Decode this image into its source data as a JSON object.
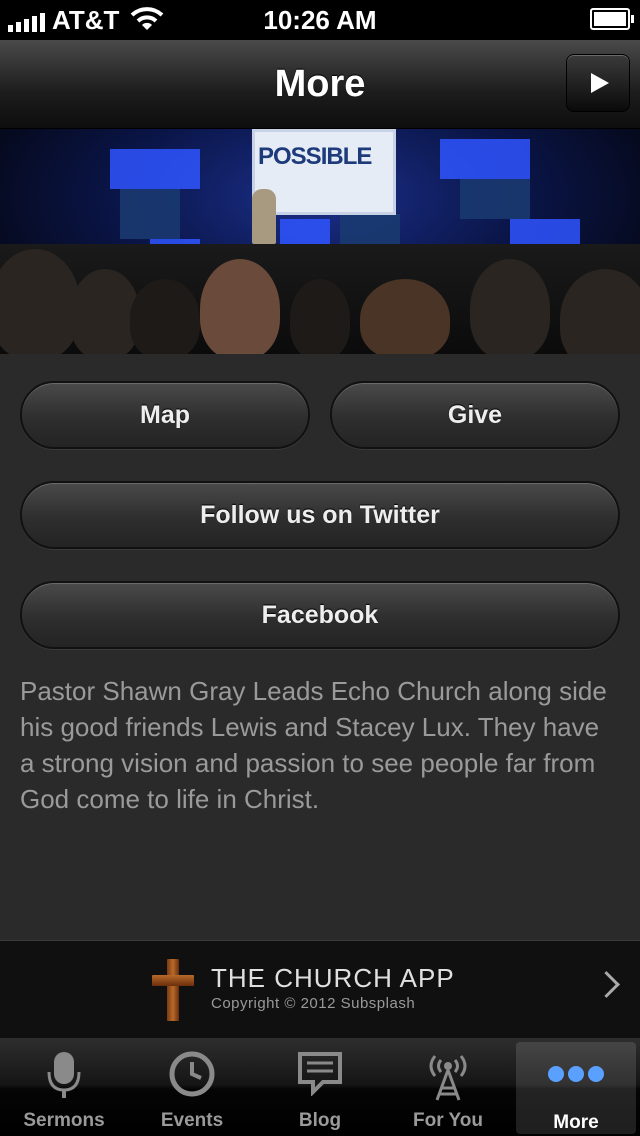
{
  "status_bar": {
    "carrier": "AT&T",
    "time": "10:26 AM"
  },
  "nav": {
    "title": "More"
  },
  "hero": {
    "screen_text": "POSSIBLE"
  },
  "buttons": {
    "map": "Map",
    "give": "Give",
    "twitter": "Follow us on Twitter",
    "facebook": "Facebook"
  },
  "description": "Pastor Shawn Gray Leads Echo Church along side his good friends Lewis and Stacey Lux. They have a strong vision and passion to see people far from God come to life in Christ.",
  "footer": {
    "title": "THE CHURCH APP",
    "copyright": "Copyright © 2012 Subsplash"
  },
  "tabs": [
    {
      "label": "Sermons",
      "icon": "microphone-icon"
    },
    {
      "label": "Events",
      "icon": "clock-icon"
    },
    {
      "label": "Blog",
      "icon": "speech-bubble-icon"
    },
    {
      "label": "For You",
      "icon": "broadcast-tower-icon"
    },
    {
      "label": "More",
      "icon": "more-dots-icon",
      "active": true
    }
  ],
  "colors": {
    "accent_blue": "#5aa0ff",
    "background": "#2a2a2a"
  }
}
